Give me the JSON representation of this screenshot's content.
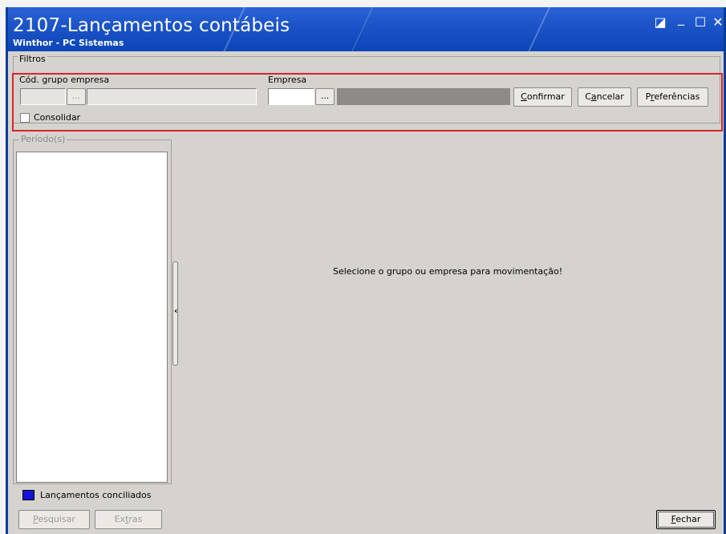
{
  "window": {
    "title": "2107-Lançamentos contábeis",
    "subtitle": "Winthor - PC Sistemas",
    "controls": {
      "restore": "◪",
      "minimize": "_",
      "maximize": "☐",
      "close": "✕"
    }
  },
  "filtros": {
    "legend": "Filtros",
    "grupo_label": "Cód. grupo empresa",
    "empresa_label": "Empresa",
    "dots_label": "...",
    "consolidar_label": "Consolidar",
    "confirmar": {
      "pre": "",
      "mn": "C",
      "post": "onfirmar"
    },
    "cancelar": {
      "pre": "C",
      "mn": "a",
      "post": "ncelar"
    },
    "preferencias": {
      "pre": "P",
      "mn": "r",
      "post": "eferências"
    },
    "highlight_color": "#d4262c"
  },
  "periodo": {
    "legend": "Período(s)"
  },
  "main": {
    "message": "Selecione o grupo ou empresa para movimentação!"
  },
  "footer": {
    "legend_label": "Lançamentos conciliados",
    "legend_color": "#1414d8",
    "pesquisar": {
      "pre": "",
      "mn": "P",
      "post": "esquisar"
    },
    "extras": {
      "pre": "Ex",
      "mn": "t",
      "post": "ras"
    },
    "fechar": {
      "pre": "",
      "mn": "F",
      "post": "echar"
    }
  }
}
